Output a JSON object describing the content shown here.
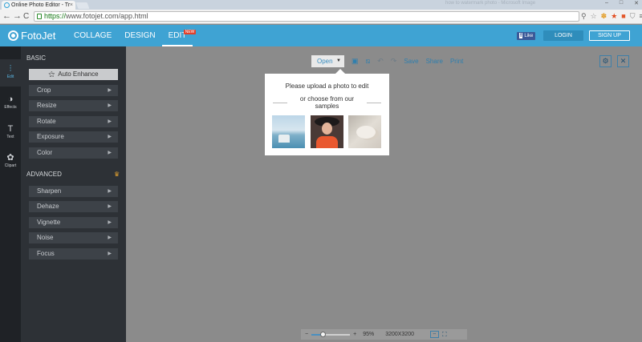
{
  "browser": {
    "tab_title": "Online Photo Editor - Tr",
    "tab_close": "×",
    "window_title_faded": "how to watermark photo - Microsoft Image",
    "nav_back": "←",
    "nav_forward": "→",
    "nav_reload": "C",
    "url_scheme": "https://",
    "url_host": "www.fotojet.com",
    "url_path": "/app.html",
    "window_buttons": [
      "–",
      "□",
      "✕"
    ]
  },
  "header": {
    "logo_text": "FotoJet",
    "nav": [
      {
        "label": "COLLAGE"
      },
      {
        "label": "DESIGN"
      },
      {
        "label": "EDIT",
        "badge": "NEW"
      }
    ],
    "fb_like": "Like",
    "fb_f": "f",
    "login": "LOGIN",
    "signup": "SIGN UP"
  },
  "rail": {
    "items": [
      {
        "label": "Edit",
        "icon": "sliders-icon",
        "glyph": "⫶"
      },
      {
        "label": "Effects",
        "icon": "effects-icon",
        "glyph": "◑"
      },
      {
        "label": "Text",
        "icon": "text-icon",
        "glyph": "T"
      },
      {
        "label": "Clipart",
        "icon": "clipart-icon",
        "glyph": "✿"
      }
    ]
  },
  "panel": {
    "basic_title": "BASIC",
    "auto_enhance": "Auto Enhance",
    "basic_items": [
      "Crop",
      "Resize",
      "Rotate",
      "Exposure",
      "Color"
    ],
    "advanced_title": "ADVANCED",
    "advanced_items": [
      "Sharpen",
      "Dehaze",
      "Vignette",
      "Noise",
      "Focus"
    ],
    "arrow": "▶"
  },
  "toolbar": {
    "open": "Open",
    "caret": "▼",
    "save": "Save",
    "share": "Share",
    "print": "Print"
  },
  "popup": {
    "line1": "Please upload a photo to edit",
    "line2": "or choose from our samples"
  },
  "zoom": {
    "minus": "−",
    "plus": "+",
    "percent": "95%",
    "size": "3200X3200",
    "level": 0.3
  },
  "colors": {
    "header_bg": "#3fa3d3",
    "panel_bg": "#2d3136",
    "canvas_bg": "#8b8b8b",
    "accent": "#2f7fae"
  }
}
